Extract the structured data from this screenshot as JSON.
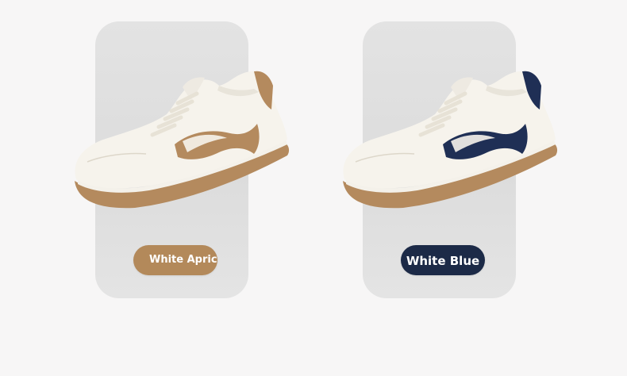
{
  "variants": [
    {
      "label": "White Apricot",
      "accent_color": "#b3895a",
      "shoe_image": "white-apricot-sneaker"
    },
    {
      "label": "White Blue",
      "accent_color": "#1c2a47",
      "shoe_image": "white-blue-sneaker"
    }
  ]
}
